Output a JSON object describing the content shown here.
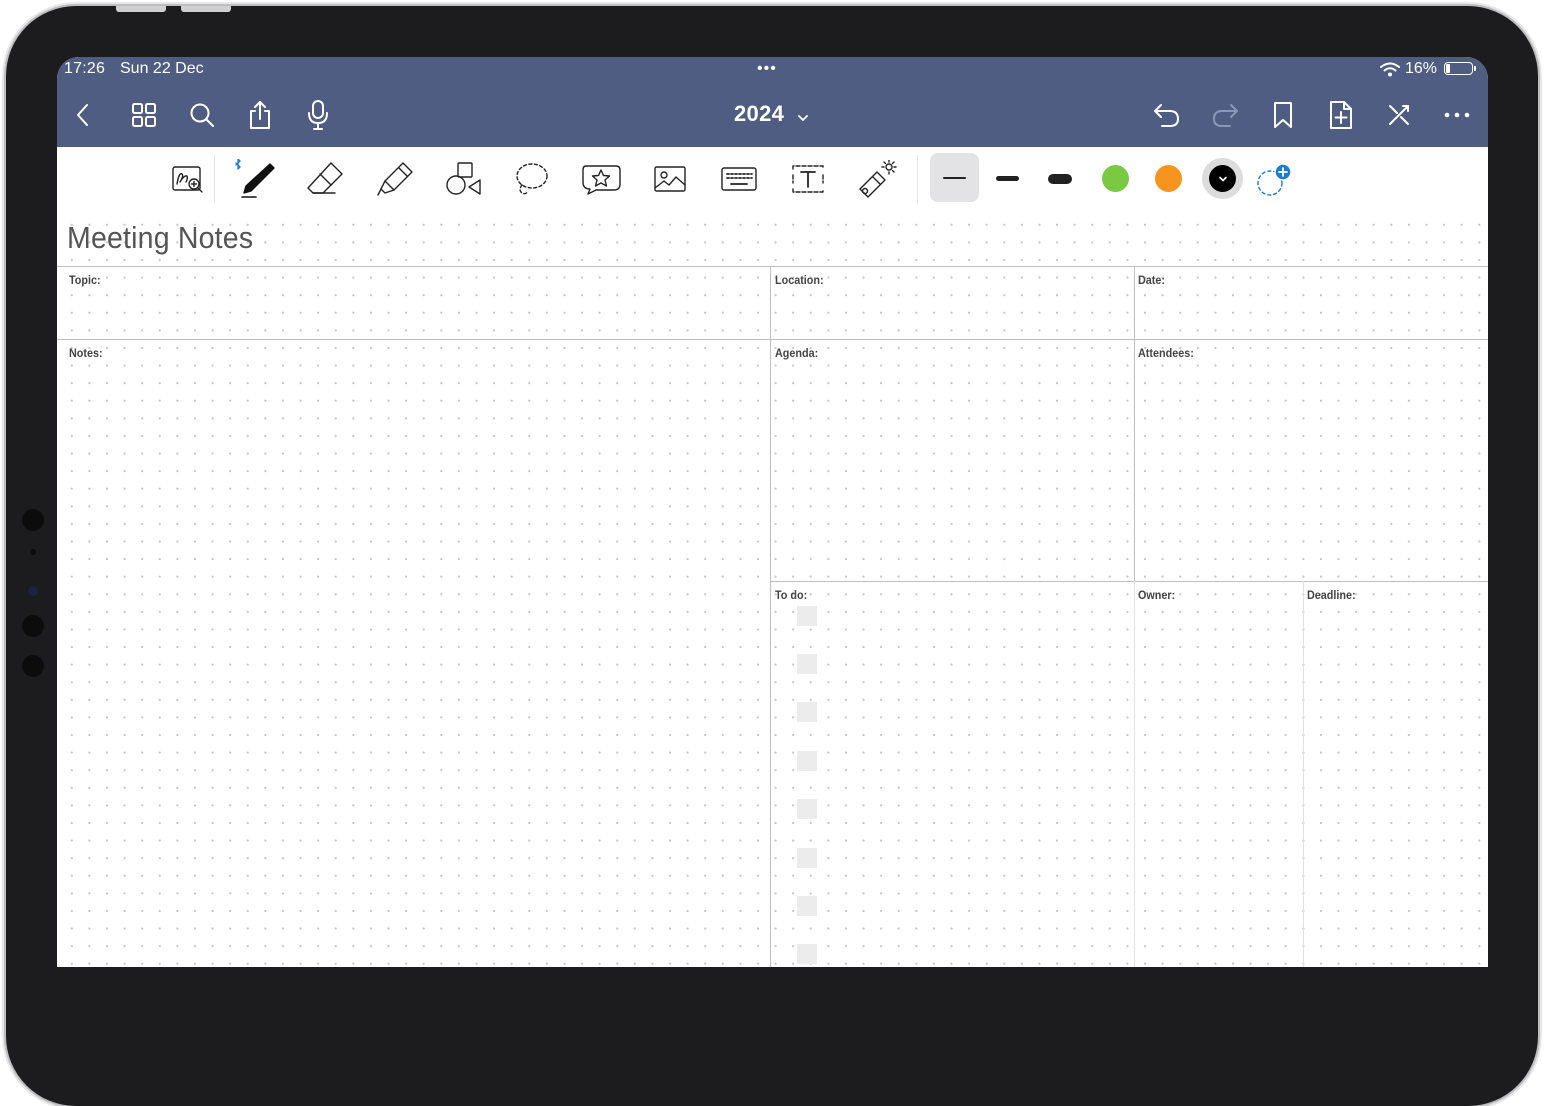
{
  "status_bar": {
    "time": "17:26",
    "date": "Sun 22 Dec",
    "center_dots": "•••",
    "battery_percent": "16%",
    "battery_level": 0.16,
    "icons": [
      "wifi-icon",
      "battery-icon"
    ]
  },
  "nav_bar": {
    "title": "2024",
    "left_icons": [
      "back-icon",
      "grid-icon",
      "search-icon",
      "share-icon",
      "microphone-icon"
    ],
    "right_icons": [
      "undo-icon",
      "redo-icon",
      "bookmark-icon",
      "add-page-icon",
      "close-icon",
      "more-icon"
    ],
    "background_color": "#4f5d82"
  },
  "toolbar": {
    "tools": [
      "zoom-handwriting-icon",
      "pen-icon",
      "eraser-icon",
      "highlighter-icon",
      "shapes-icon",
      "lasso-icon",
      "sticker-icon",
      "image-icon",
      "keyboard-icon",
      "text-box-icon",
      "laser-pointer-icon"
    ],
    "selected_tool": "pen-icon",
    "stroke_widths": [
      "thin",
      "medium",
      "thick"
    ],
    "selected_stroke": "thin",
    "colors": [
      "#7ac943",
      "#f7941d",
      "#000000"
    ],
    "selected_color": "#000000"
  },
  "page": {
    "title": "Meeting Notes",
    "labels": {
      "topic": "Topic:",
      "location": "Location:",
      "date": "Date:",
      "notes": "Notes:",
      "agenda": "Agenda:",
      "attendees": "Attendees:",
      "todo": "To do:",
      "owner": "Owner:",
      "deadline": "Deadline:"
    }
  }
}
